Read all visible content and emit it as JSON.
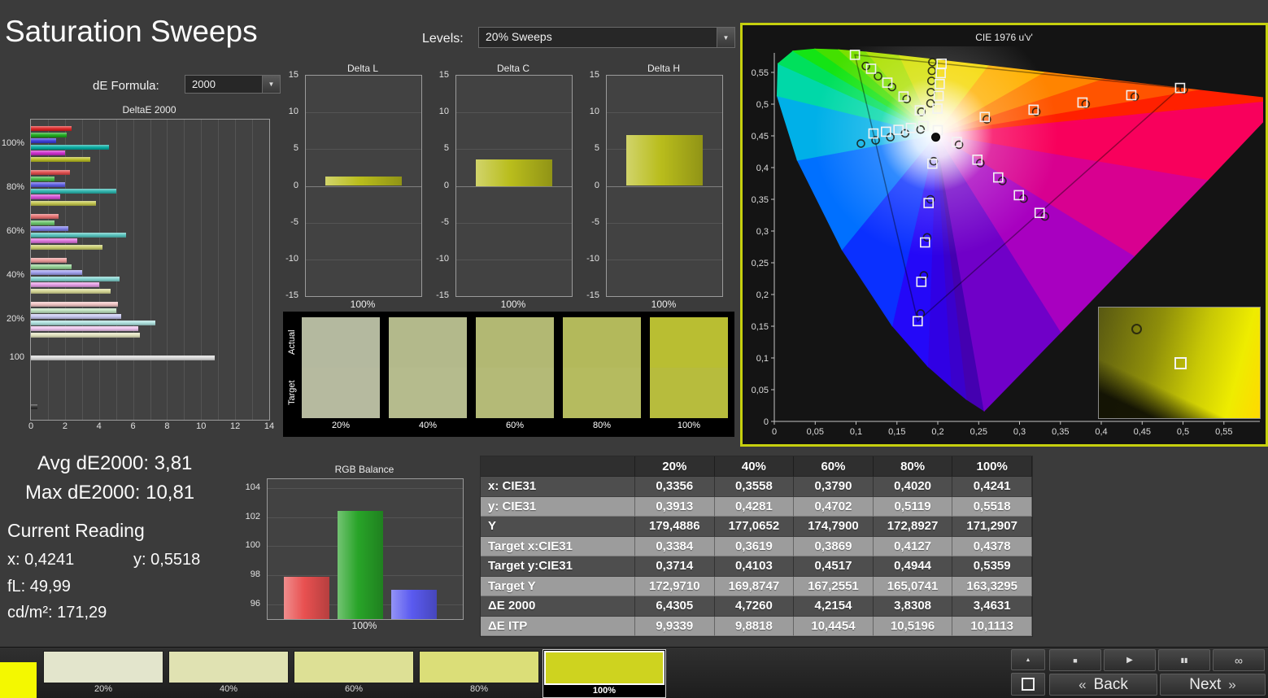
{
  "header": {
    "title": "Saturation Sweeps",
    "de_formula_label": "dE Formula:",
    "de_formula_value": "2000",
    "levels_label": "Levels:",
    "levels_value": "20% Sweeps"
  },
  "icons": {
    "chevron_down": "▼",
    "chevron_up": "▲",
    "back_chevrons": "«",
    "next_chevrons": "»"
  },
  "stats": {
    "avg": "Avg dE2000: 3,81",
    "max": "Max dE2000: 10,81",
    "current_title": "Current Reading",
    "x": "x: 0,4241",
    "y": "y: 0,5518",
    "fl": "fL: 49,99",
    "cd": "cd/m²: 171,29"
  },
  "table": {
    "col_headers": [
      "20%",
      "40%",
      "60%",
      "80%",
      "100%"
    ],
    "rows": [
      {
        "label": "x: CIE31",
        "values": [
          "0,3356",
          "0,3558",
          "0,3790",
          "0,4020",
          "0,4241"
        ]
      },
      {
        "label": "y: CIE31",
        "values": [
          "0,3913",
          "0,4281",
          "0,4702",
          "0,5119",
          "0,5518"
        ]
      },
      {
        "label": "Y",
        "values": [
          "179,4886",
          "177,0652",
          "174,7900",
          "172,8927",
          "171,2907"
        ]
      },
      {
        "label": "Target x:CIE31",
        "values": [
          "0,3384",
          "0,3619",
          "0,3869",
          "0,4127",
          "0,4378"
        ]
      },
      {
        "label": "Target y:CIE31",
        "values": [
          "0,3714",
          "0,4103",
          "0,4517",
          "0,4944",
          "0,5359"
        ]
      },
      {
        "label": "Target Y",
        "values": [
          "172,9710",
          "169,8747",
          "167,2551",
          "165,0741",
          "163,3295"
        ]
      },
      {
        "label": "ΔE 2000",
        "values": [
          "6,4305",
          "4,7260",
          "4,2154",
          "3,8308",
          "3,4631"
        ]
      },
      {
        "label": "ΔE ITP",
        "values": [
          "9,9339",
          "9,8818",
          "10,4454",
          "10,5196",
          "10,1113"
        ]
      }
    ]
  },
  "patch_compare": {
    "row_labels": [
      "Actual",
      "Target"
    ],
    "columns": [
      {
        "label": "20%",
        "actual": "#b4b99f",
        "target": "#b6ba9f"
      },
      {
        "label": "40%",
        "actual": "#b3b98b",
        "target": "#b5bb8d"
      },
      {
        "label": "60%",
        "actual": "#b2b873",
        "target": "#b4ba77"
      },
      {
        "label": "80%",
        "actual": "#b3b95b",
        "target": "#b5bb5f"
      },
      {
        "label": "100%",
        "actual": "#b9be32",
        "target": "#b7bc3d"
      }
    ]
  },
  "bottom_bar": {
    "corner_swatch_color": "#f4f800",
    "swatches": [
      {
        "label": "20%",
        "color": "#e3e5cc",
        "selected": false
      },
      {
        "label": "40%",
        "color": "#e0e2b2",
        "selected": false
      },
      {
        "label": "60%",
        "color": "#dde095",
        "selected": false
      },
      {
        "label": "80%",
        "color": "#dbde78",
        "selected": false
      },
      {
        "label": "100%",
        "color": "#ced31f",
        "selected": true
      }
    ],
    "transport": [
      {
        "name": "stop",
        "glyph": "■",
        "size": 9
      },
      {
        "name": "play",
        "glyph": "▶",
        "size": 10
      },
      {
        "name": "pause",
        "glyph": "▮▮",
        "size": 8
      },
      {
        "name": "loop",
        "glyph": "∞",
        "size": 14
      }
    ],
    "back_label": "Back",
    "next_label": "Next"
  },
  "chart_data": [
    {
      "id": "deltae2000",
      "type": "bar",
      "orientation": "horizontal",
      "title": "DeltaE 2000",
      "xlim": [
        0,
        14
      ],
      "xticks": [
        0,
        2,
        4,
        6,
        8,
        10,
        12,
        14
      ],
      "groups": [
        {
          "label": "100%",
          "bars": [
            {
              "color": "#dc2020",
              "value": 2.4
            },
            {
              "color": "#18a818",
              "value": 2.1
            },
            {
              "color": "#3838dc",
              "value": 1.5
            },
            {
              "color": "#00aaa0",
              "value": 4.6
            },
            {
              "color": "#cc28cc",
              "value": 2.0
            },
            {
              "color": "#b8bc20",
              "value": 3.5
            }
          ]
        },
        {
          "label": "80%",
          "bars": [
            {
              "color": "#e04848",
              "value": 2.3
            },
            {
              "color": "#40b440",
              "value": 1.4
            },
            {
              "color": "#5858e0",
              "value": 2.0
            },
            {
              "color": "#28b4ac",
              "value": 5.0
            },
            {
              "color": "#d44cd4",
              "value": 1.7
            },
            {
              "color": "#c0c348",
              "value": 3.8
            }
          ]
        },
        {
          "label": "60%",
          "bars": [
            {
              "color": "#e66e6e",
              "value": 1.6
            },
            {
              "color": "#66c266",
              "value": 1.4
            },
            {
              "color": "#7a7ae6",
              "value": 2.2
            },
            {
              "color": "#52c2bc",
              "value": 5.6
            },
            {
              "color": "#dc72dc",
              "value": 2.7
            },
            {
              "color": "#c9cc6a",
              "value": 4.2
            }
          ]
        },
        {
          "label": "40%",
          "bars": [
            {
              "color": "#ec9898",
              "value": 2.1
            },
            {
              "color": "#90d090",
              "value": 2.4
            },
            {
              "color": "#9c9cec",
              "value": 3.0
            },
            {
              "color": "#7ed0cc",
              "value": 5.2
            },
            {
              "color": "#e49ae4",
              "value": 4.0
            },
            {
              "color": "#d4d692",
              "value": 4.7
            }
          ]
        },
        {
          "label": "20%",
          "bars": [
            {
              "color": "#f0c2c2",
              "value": 5.1
            },
            {
              "color": "#bcdfbc",
              "value": 5.0
            },
            {
              "color": "#c6c6f0",
              "value": 5.3
            },
            {
              "color": "#aadfdc",
              "value": 7.3
            },
            {
              "color": "#ecc2ec",
              "value": 6.3
            },
            {
              "color": "#e0e1bc",
              "value": 6.4
            }
          ]
        },
        {
          "label": "100",
          "bars": [
            {
              "color": "#d9d9d9",
              "value": 10.81
            }
          ]
        }
      ],
      "extra_bar": {
        "color": "#2c2c2c",
        "value": 0.4
      }
    },
    {
      "id": "delta_l",
      "type": "bar",
      "title": "Delta L",
      "ylim": [
        -15,
        15
      ],
      "yticks": [
        15,
        10,
        5,
        0,
        -5,
        -10,
        -15
      ],
      "categories": [
        "100%"
      ],
      "values": [
        1.3
      ],
      "color": "#b9bd1c"
    },
    {
      "id": "delta_c",
      "type": "bar",
      "title": "Delta C",
      "ylim": [
        -15,
        15
      ],
      "yticks": [
        15,
        10,
        5,
        0,
        -5,
        -10,
        -15
      ],
      "categories": [
        "100%"
      ],
      "values": [
        3.6
      ],
      "color": "#b9bd1c"
    },
    {
      "id": "delta_h",
      "type": "bar",
      "title": "Delta H",
      "ylim": [
        -15,
        15
      ],
      "yticks": [
        15,
        10,
        5,
        0,
        -5,
        -10,
        -15
      ],
      "categories": [
        "100%"
      ],
      "values": [
        6.9
      ],
      "color": "#b9bd1c"
    },
    {
      "id": "rgb_balance",
      "type": "bar",
      "title": "RGB Balance",
      "ylim": [
        95,
        104.6
      ],
      "yticks": [
        104,
        102,
        100,
        98,
        96
      ],
      "categories": [
        "100%"
      ],
      "series": [
        {
          "name": "Red",
          "value": 97.9,
          "color": "#e85050"
        },
        {
          "name": "Green",
          "value": 102.4,
          "color": "#28a428"
        },
        {
          "name": "Blue",
          "value": 97.0,
          "color": "#5a5af0"
        }
      ]
    },
    {
      "id": "cie_1976",
      "type": "scatter",
      "title": "CIE 1976 u'v'",
      "xlim": [
        0,
        0.59
      ],
      "ylim": [
        0,
        0.575
      ],
      "ticks": [
        0,
        0.05,
        0.1,
        0.15,
        0.2,
        0.25,
        0.3,
        0.35,
        0.4,
        0.45,
        0.5,
        0.55
      ],
      "tick_labels": [
        "0",
        "0,05",
        "0,1",
        "0,15",
        "0,2",
        "0,25",
        "0,3",
        "0,35",
        "0,4",
        "0,45",
        "0,5",
        "0,55"
      ],
      "locus": [
        [
          0.2568,
          0.0166,
          "#4400b0"
        ],
        [
          0.2347,
          0.035,
          "#3a00cc"
        ],
        [
          0.2161,
          0.0549,
          "#3000e4"
        ],
        [
          0.1877,
          0.0871,
          "#2408f8"
        ],
        [
          0.1441,
          0.151,
          "#0a30ff"
        ],
        [
          0.0828,
          0.2708,
          "#0070ff"
        ],
        [
          0.0282,
          0.4117,
          "#00b0e8"
        ],
        [
          0.0035,
          0.5131,
          "#00d8a8"
        ],
        [
          0.0046,
          0.5639,
          "#00e05c"
        ],
        [
          0.0231,
          0.5837,
          "#14e414"
        ],
        [
          0.0501,
          0.5868,
          "#44e000"
        ],
        [
          0.0792,
          0.5856,
          "#7ce000"
        ],
        [
          0.1127,
          0.5821,
          "#ace000"
        ],
        [
          0.1531,
          0.5766,
          "#d4e000"
        ],
        [
          0.2026,
          0.5694,
          "#f4d800"
        ],
        [
          0.2623,
          0.5604,
          "#ffb000"
        ],
        [
          0.3315,
          0.5501,
          "#ff8400"
        ],
        [
          0.4035,
          0.5393,
          "#ff5400"
        ],
        [
          0.5203,
          0.5219,
          "#ff2000"
        ],
        [
          0.6234,
          0.5065,
          "#f8005c"
        ],
        [
          0.53,
          0.38,
          "#d80090"
        ],
        [
          0.44,
          0.26,
          "#a800c0"
        ],
        [
          0.35,
          0.14,
          "#7000c8"
        ]
      ],
      "gamut_triangle": [
        [
          0.4964,
          0.5255
        ],
        [
          0.0986,
          0.5777
        ],
        [
          0.1754,
          0.1579
        ]
      ],
      "white_point": [
        0.1975,
        0.448
      ],
      "targets": [
        [
          0.2575,
          0.4797
        ],
        [
          0.3172,
          0.4912
        ],
        [
          0.377,
          0.5026
        ],
        [
          0.4367,
          0.5141
        ],
        [
          0.4964,
          0.5255
        ],
        [
          0.178,
          0.4902
        ],
        [
          0.1581,
          0.5121
        ],
        [
          0.1383,
          0.5339
        ],
        [
          0.1184,
          0.5558
        ],
        [
          0.0986,
          0.5777
        ],
        [
          0.1933,
          0.4062
        ],
        [
          0.1888,
          0.3441
        ],
        [
          0.1844,
          0.2821
        ],
        [
          0.1799,
          0.22
        ],
        [
          0.1754,
          0.1579
        ],
        [
          0.1825,
          0.4654
        ],
        [
          0.1672,
          0.4625
        ],
        [
          0.1519,
          0.4595
        ],
        [
          0.1366,
          0.4566
        ],
        [
          0.1213,
          0.4537
        ],
        [
          0.2232,
          0.4404
        ],
        [
          0.2485,
          0.4124
        ],
        [
          0.2739,
          0.3845
        ],
        [
          0.2992,
          0.3565
        ],
        [
          0.3246,
          0.3286
        ],
        [
          0.1996,
          0.493
        ],
        [
          0.2011,
          0.5129
        ],
        [
          0.2024,
          0.5317
        ],
        [
          0.2036,
          0.5488
        ],
        [
          0.2047,
          0.5637
        ],
        [
          0.2,
          0.459
        ]
      ],
      "measurements": [
        [
          0.26,
          0.476
        ],
        [
          0.3205,
          0.488
        ],
        [
          0.381,
          0.5
        ],
        [
          0.441,
          0.5115
        ],
        [
          0.501,
          0.523
        ],
        [
          0.18,
          0.488
        ],
        [
          0.162,
          0.508
        ],
        [
          0.144,
          0.527
        ],
        [
          0.127,
          0.544
        ],
        [
          0.112,
          0.56
        ],
        [
          0.195,
          0.41
        ],
        [
          0.191,
          0.35
        ],
        [
          0.187,
          0.29
        ],
        [
          0.183,
          0.23
        ],
        [
          0.179,
          0.17
        ],
        [
          0.179,
          0.46
        ],
        [
          0.16,
          0.454
        ],
        [
          0.142,
          0.448
        ],
        [
          0.124,
          0.443
        ],
        [
          0.106,
          0.438
        ],
        [
          0.226,
          0.436
        ],
        [
          0.252,
          0.407
        ],
        [
          0.279,
          0.379
        ],
        [
          0.305,
          0.351
        ],
        [
          0.331,
          0.323
        ],
        [
          0.1911,
          0.5013
        ],
        [
          0.1916,
          0.5189
        ],
        [
          0.1923,
          0.5367
        ],
        [
          0.1928,
          0.5525
        ],
        [
          0.1934,
          0.5661
        ]
      ],
      "inset": {
        "circle": [
          0.2,
          0.15
        ],
        "square": [
          0.47,
          0.45
        ]
      }
    }
  ]
}
